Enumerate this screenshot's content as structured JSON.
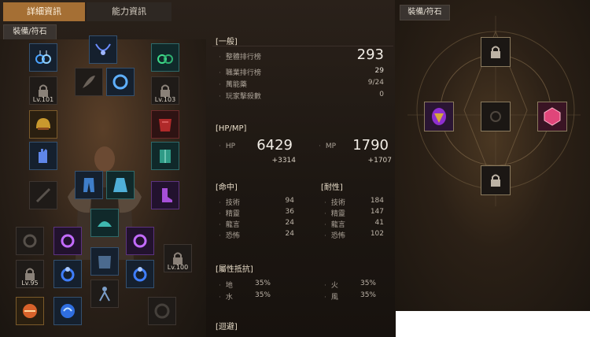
{
  "tabs": {
    "detail": "詳細資訊",
    "ability": "能力資訊"
  },
  "equipment_label": "裝備/符石",
  "levels": {
    "l101": "Lv.101",
    "l103": "Lv.103",
    "l95": "Lv.95",
    "l100": "Lv.100"
  },
  "general": {
    "title": "[一般]",
    "rows": [
      {
        "label": "整體排行榜",
        "value": "293"
      },
      {
        "label": "職業排行榜",
        "value": "29"
      },
      {
        "label": "萬能藥",
        "value": "9/24"
      },
      {
        "label": "玩家擊殺數",
        "value": "0"
      }
    ]
  },
  "hpmp": {
    "title": "[HP/MP]",
    "hp_label": "HP",
    "hp_value": "6429",
    "hp_bonus": "+3314",
    "mp_label": "MP",
    "mp_value": "1790",
    "mp_bonus": "+1707"
  },
  "accuracy": {
    "title": "[命中]",
    "rows": [
      {
        "label": "技術",
        "value": "94"
      },
      {
        "label": "精靈",
        "value": "36"
      },
      {
        "label": "龍言",
        "value": "24"
      },
      {
        "label": "恐怖",
        "value": "24"
      }
    ]
  },
  "resistance": {
    "title": "[耐性]",
    "rows": [
      {
        "label": "技術",
        "value": "184"
      },
      {
        "label": "精靈",
        "value": "147"
      },
      {
        "label": "龍言",
        "value": "41"
      },
      {
        "label": "恐怖",
        "value": "102"
      }
    ]
  },
  "elemental": {
    "title": "[屬性抵抗]",
    "rows": [
      {
        "label": "地",
        "value": "35%"
      },
      {
        "label": "火",
        "value": "35%"
      },
      {
        "label": "水",
        "value": "35%"
      },
      {
        "label": "風",
        "value": "35%"
      }
    ]
  },
  "evasion": {
    "title": "[迴避]"
  },
  "colors": {
    "accent_tab": "#a56f34",
    "panel_bg": "#1d1712"
  }
}
